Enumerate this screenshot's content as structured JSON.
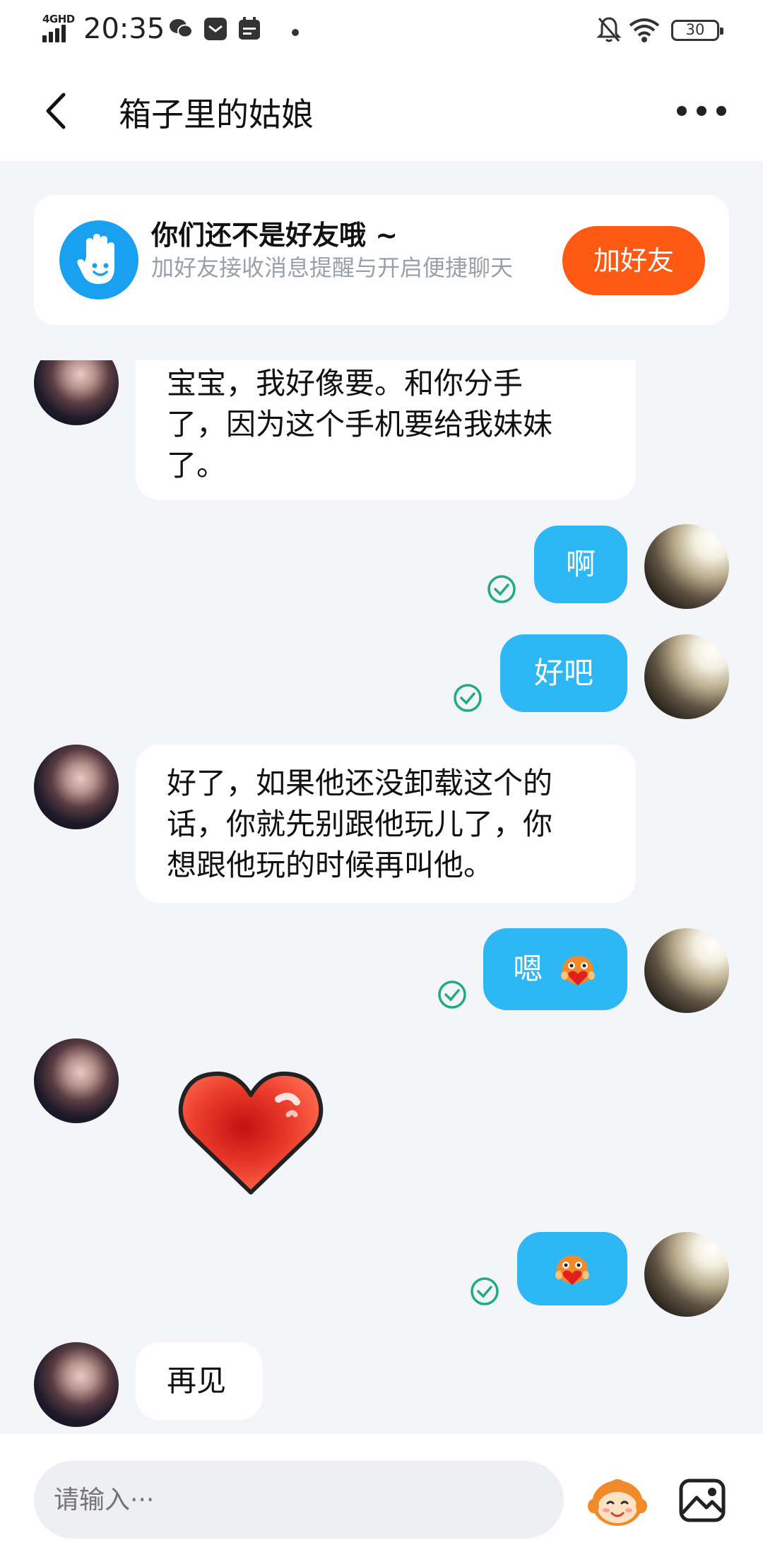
{
  "status_bar": {
    "network": "4GHD",
    "time": "20:35",
    "battery": "30"
  },
  "header": {
    "title": "箱子里的姑娘"
  },
  "friend_banner": {
    "title": "你们还不是好友哦 ~",
    "description": "加好友接收消息提醒与开启便捷聊天",
    "button_label": "加好友"
  },
  "messages": [
    {
      "side": "left",
      "text_lines": [
        "宝宝，我好像要。和你分手",
        "了，因为这个手机要给我妹妹",
        "了。"
      ]
    },
    {
      "side": "right",
      "text": "啊",
      "read": true
    },
    {
      "side": "right",
      "text": "好吧",
      "read": true
    },
    {
      "side": "left",
      "text_lines": [
        "好了，如果他还没卸载这个的",
        "话，你就先别跟他玩儿了，你",
        "想跟他玩的时候再叫他。"
      ]
    },
    {
      "side": "right",
      "text": "嗯",
      "sticker": "heart-hug-emoji",
      "read": true
    },
    {
      "side": "left",
      "sticker": "red-heart-sticker"
    },
    {
      "side": "right",
      "sticker": "heart-hug-emoji",
      "read": true
    },
    {
      "side": "left",
      "text": "再见"
    }
  ],
  "input_bar": {
    "placeholder": "请输入···"
  },
  "colors": {
    "accent_blue": "#2eb7f5",
    "add_friend_orange": "#ff5a14",
    "read_check_green": "#1fae7a"
  }
}
